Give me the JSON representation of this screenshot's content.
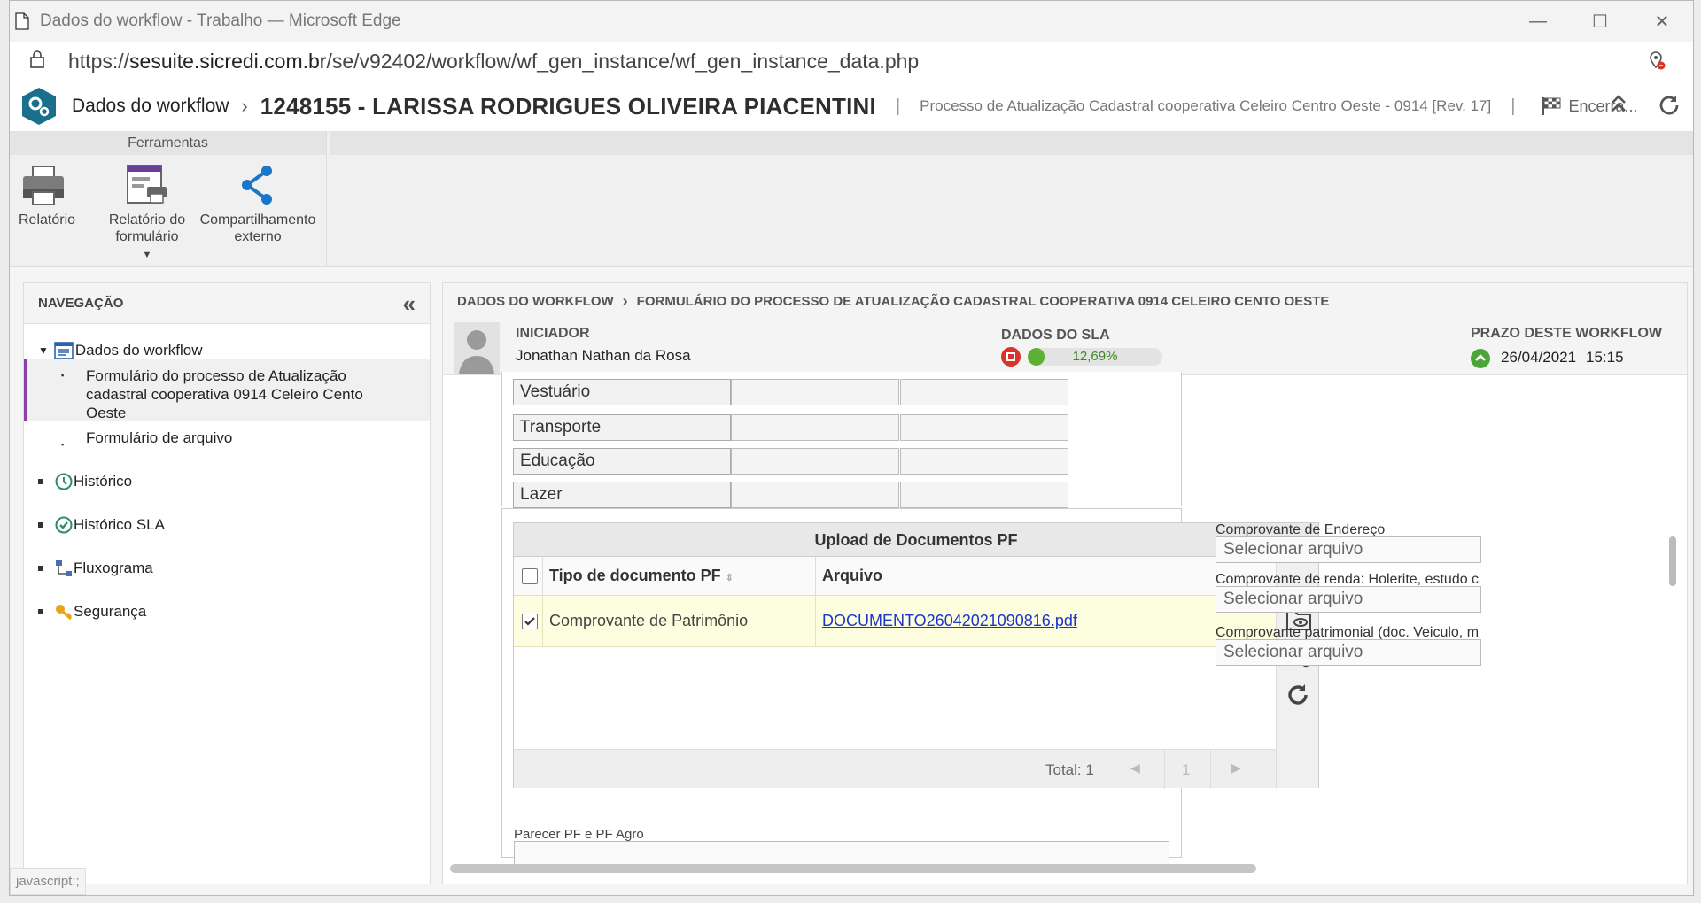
{
  "window": {
    "title": "Dados do workflow - Trabalho — Microsoft Edge",
    "url_prefix": "https://",
    "url_host": "sesuite.sicredi.com.br",
    "url_path": "/se/v92402/workflow/wf_gen_instance/wf_gen_instance_data.php"
  },
  "header": {
    "crumb": "Dados do workflow",
    "title": "1248155 - LARISSA RODRIGUES OLIVEIRA PIACENTINI",
    "process": "Processo de Atualização Cadastral cooperativa Celeiro Centro Oeste - 0914 [Rev. 17]",
    "status": "Encerra..."
  },
  "toolbar": {
    "group_title": "Ferramentas",
    "report": "Relatório",
    "form_report_line1": "Relatório do",
    "form_report_line2": "formulário",
    "share_line1": "Compartilhamento",
    "share_line2": "externo"
  },
  "nav": {
    "title": "NAVEGAÇÃO",
    "root": "Dados do workflow",
    "sub1_line1": "Formulário do processo de Atualização",
    "sub1_line2": "cadastral cooperativa 0914 Celeiro Cento",
    "sub1_line3": "Oeste",
    "sub2": "Formulário de arquivo",
    "items": [
      "Histórico",
      "Histórico SLA",
      "Fluxograma",
      "Segurança"
    ]
  },
  "main": {
    "crumb1": "DADOS DO WORKFLOW",
    "crumb2": "FORMULÁRIO DO PROCESSO DE ATUALIZAÇÃO CADASTRAL COOPERATIVA 0914 CELEIRO CENTO OESTE",
    "initiator_label": "INICIADOR",
    "initiator": "Jonathan Nathan da Rosa",
    "sla_label": "DADOS DO SLA",
    "sla_value": "12,69%",
    "sla_progress": 0.1269,
    "deadline_label": "PRAZO DESTE WORKFLOW",
    "deadline_date": "26/04/2021",
    "deadline_time": "15:15"
  },
  "form": {
    "rows": [
      "Vestuário",
      "Transporte",
      "Educação",
      "Lazer"
    ],
    "upload_title": "Upload de Documentos PF",
    "col_type": "Tipo de documento PF",
    "col_file": "Arquivo",
    "doc_type": "Comprovante de Patrimônio",
    "doc_file": "DOCUMENTO26042021090816.pdf",
    "total": "Total: 1",
    "page": "1",
    "parecer_label": "Parecer PF e PF Agro",
    "right_fields": [
      {
        "label": "Comprovante de Endereço",
        "value": "Selecionar arquivo"
      },
      {
        "label": "Comprovante de renda: Holerite, estudo c",
        "value": "Selecionar arquivo"
      },
      {
        "label": "Comprovante patrimonial (doc. Veiculo, m",
        "value": "Selecionar arquivo"
      }
    ]
  },
  "statusbar": "javascript:;",
  "colors": {
    "accent": "#2b7fc6",
    "logo": "#1a6f8c",
    "nav_marker": "#8b3fa8",
    "row_highlight": "#fdfde0"
  }
}
